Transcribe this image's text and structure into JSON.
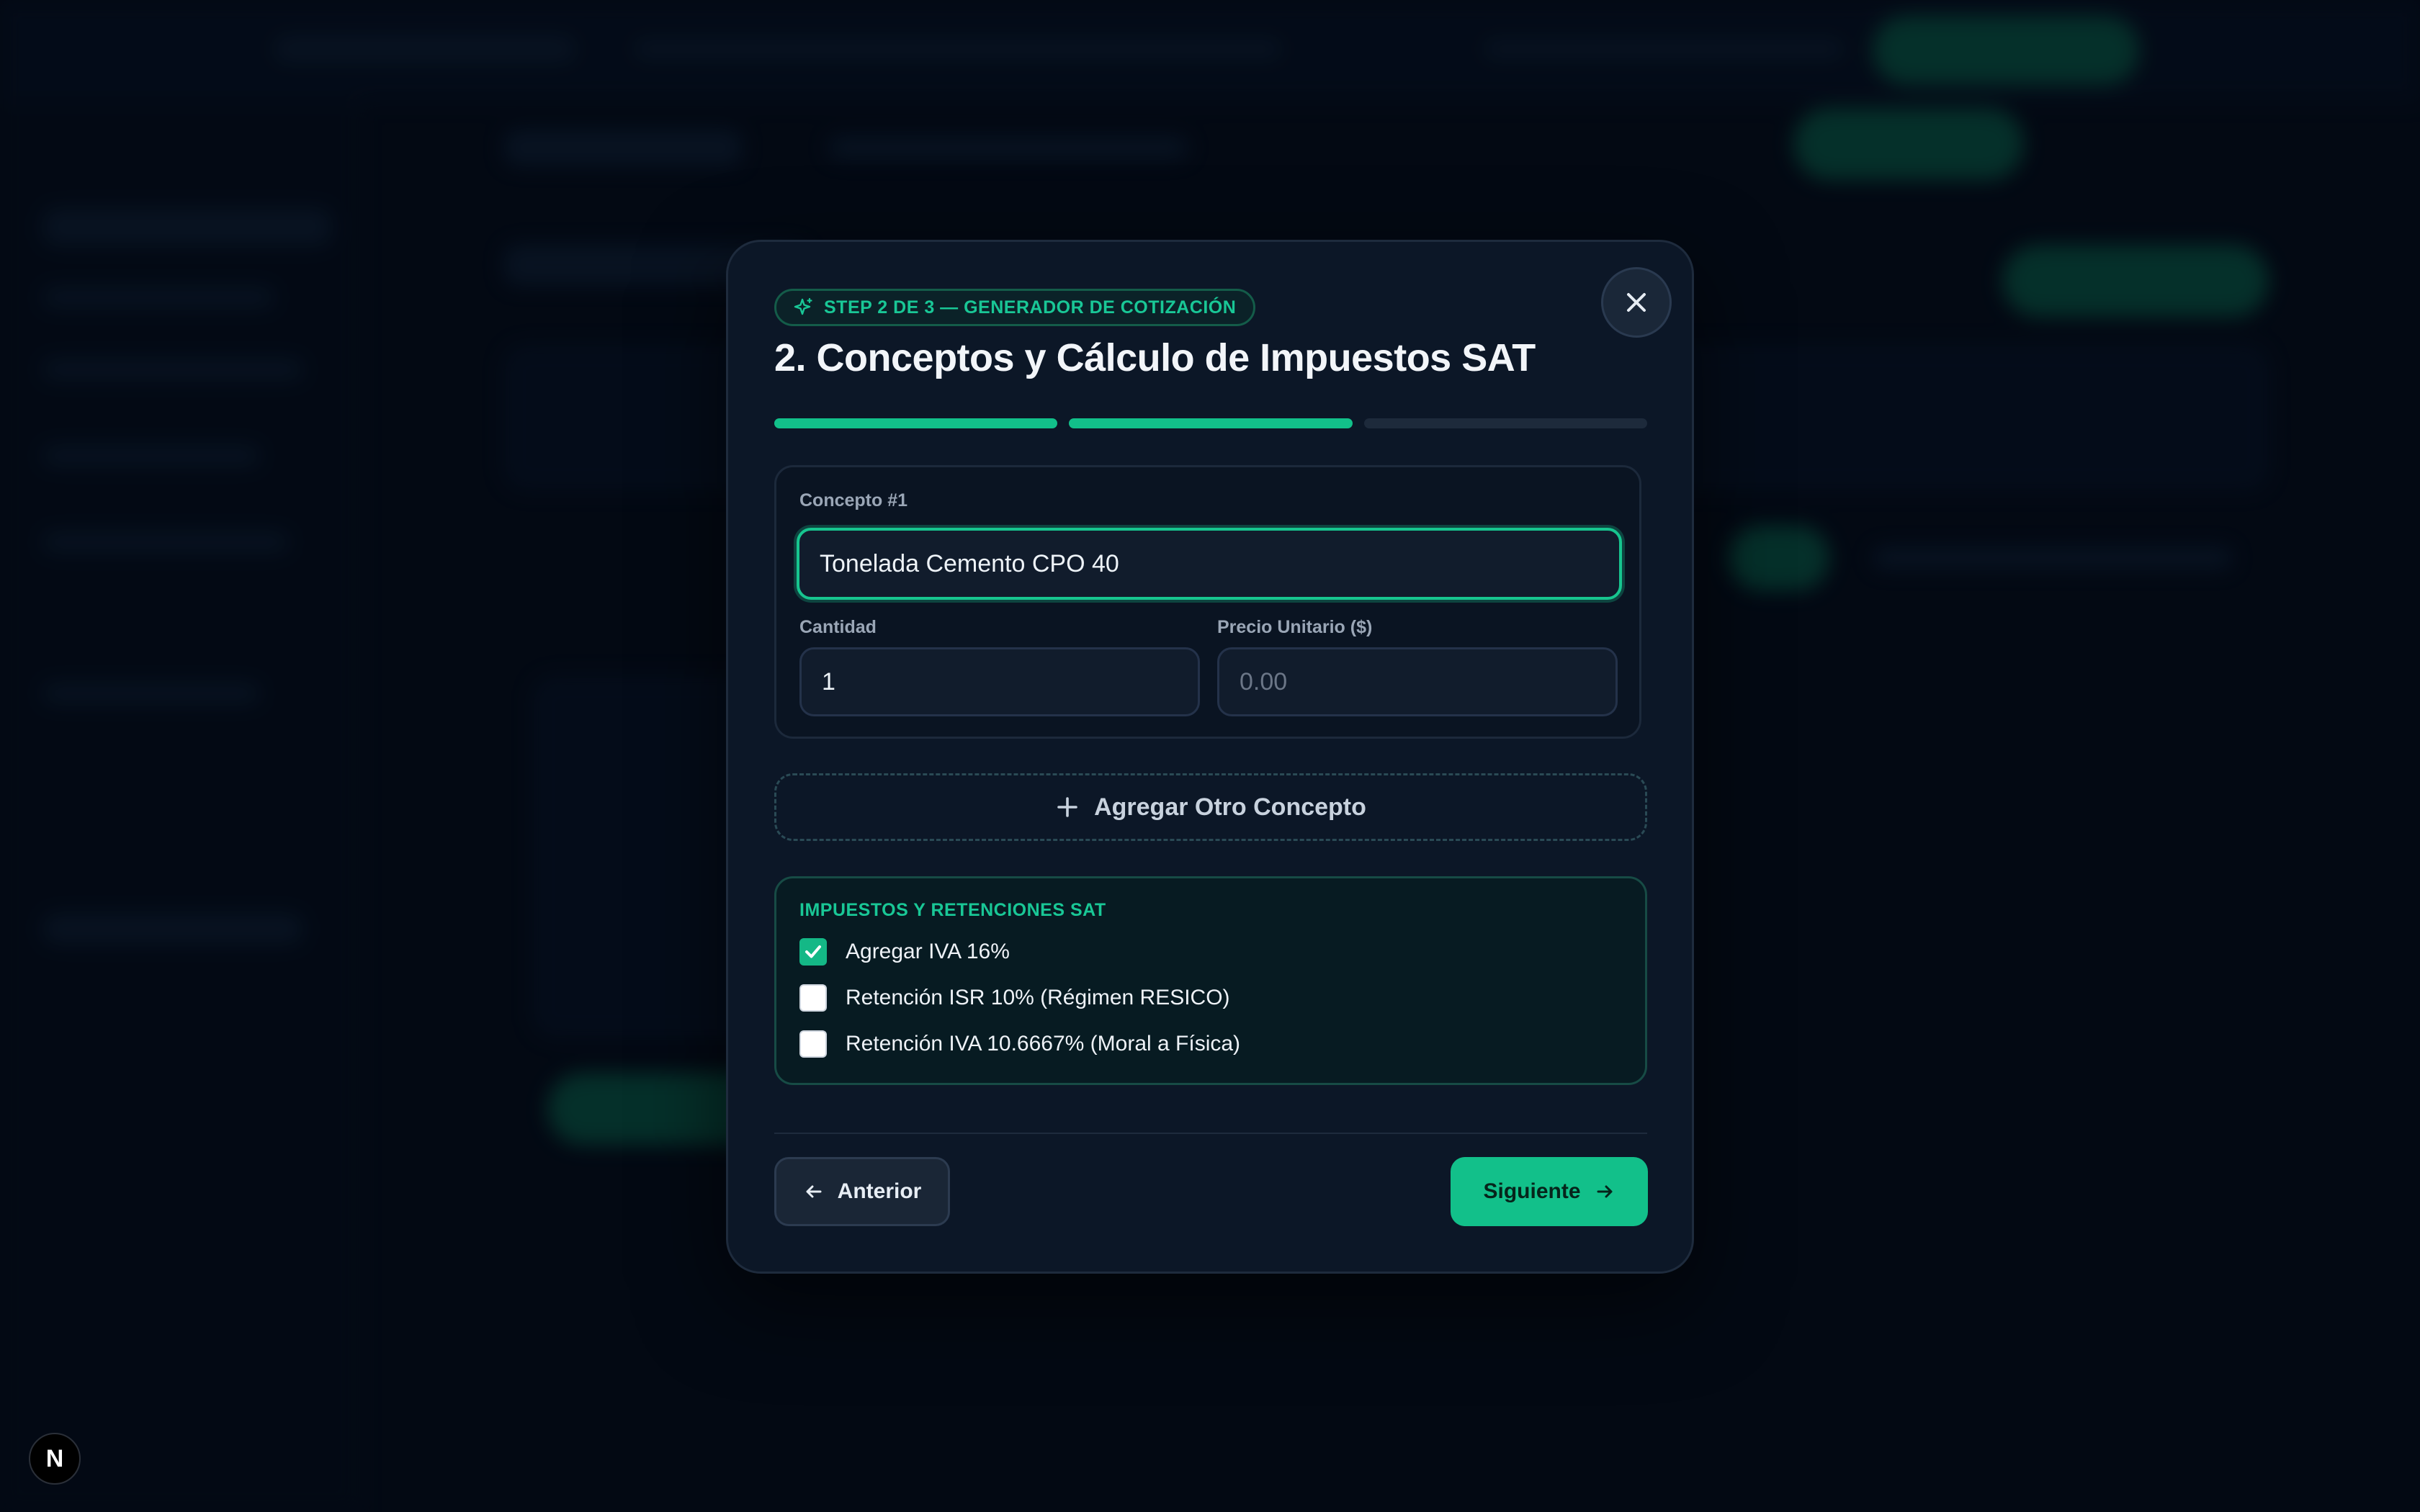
{
  "modal": {
    "step_badge": "STEP 2 DE 3 — GENERADOR DE COTIZACIÓN",
    "title": "2. Conceptos y Cálculo de Impuestos SAT",
    "progress": {
      "current_step": 2,
      "total_steps": 3
    },
    "concept": {
      "label": "Concepto #1",
      "description_value": "Tonelada Cemento CPO 40",
      "quantity_label": "Cantidad",
      "quantity_value": "1",
      "unit_price_label": "Precio Unitario ($)",
      "unit_price_placeholder": "0.00"
    },
    "add_concept_label": "Agregar Otro Concepto",
    "taxes": {
      "title": "IMPUESTOS Y RETENCIONES SAT",
      "options": [
        {
          "label": "Agregar IVA 16%",
          "checked": true
        },
        {
          "label": "Retención ISR 10% (Régimen RESICO)",
          "checked": false
        },
        {
          "label": "Retención IVA 10.6667% (Moral a Física)",
          "checked": false
        }
      ]
    },
    "prev_label": "Anterior",
    "next_label": "Siguiente"
  },
  "dev_badge": "N",
  "colors": {
    "accent": "#12c08a",
    "modal_bg": "#0c1727",
    "page_bg": "#040b17"
  }
}
